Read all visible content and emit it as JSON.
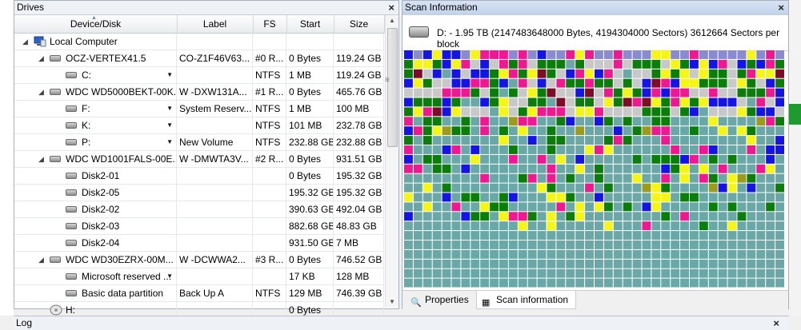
{
  "drives_panel": {
    "title": "Drives",
    "close": "×",
    "columns": [
      "Device/Disk",
      "Label",
      "FS",
      "Start",
      "Size"
    ],
    "rows": [
      {
        "level": 0,
        "expanded": true,
        "icon": "computer-icon",
        "name": "Local Computer",
        "label": "",
        "fs": "",
        "start": "",
        "size": "",
        "dropdown": false
      },
      {
        "level": 1,
        "expanded": true,
        "icon": "hard-disk-icon",
        "name": "OCZ-VERTEX41.5",
        "label": "CO-Z1F46V63...",
        "fs": "#0 R...",
        "start": "0 Bytes",
        "size": "119.24 GB",
        "dropdown": false
      },
      {
        "level": 2,
        "expanded": false,
        "icon": "partition-icon",
        "name": "C:",
        "label": "",
        "fs": "NTFS",
        "start": "1 MB",
        "size": "119.24 GB",
        "dropdown": true
      },
      {
        "level": 1,
        "expanded": true,
        "icon": "hard-disk-icon",
        "name": "WDC WD5000BEKT-00K...",
        "label": "W -DXW131A...",
        "fs": "#1 R...",
        "start": "0 Bytes",
        "size": "465.76 GB",
        "dropdown": false
      },
      {
        "level": 2,
        "expanded": false,
        "icon": "partition-icon",
        "name": "F:",
        "label": "System Reserv...",
        "fs": "NTFS",
        "start": "1 MB",
        "size": "100 MB",
        "dropdown": true
      },
      {
        "level": 2,
        "expanded": false,
        "icon": "partition-icon",
        "name": "K:",
        "label": "",
        "fs": "NTFS",
        "start": "101 MB",
        "size": "232.78 GB",
        "dropdown": true
      },
      {
        "level": 2,
        "expanded": false,
        "icon": "partition-icon",
        "name": "P:",
        "label": "New Volume",
        "fs": "NTFS",
        "start": "232.88 GB",
        "size": "232.88 GB",
        "dropdown": true
      },
      {
        "level": 1,
        "expanded": true,
        "icon": "hard-disk-icon",
        "name": "WDC WD1001FALS-00E...",
        "label": "W -DMWTA3V...",
        "fs": "#2 R...",
        "start": "0 Bytes",
        "size": "931.51 GB",
        "dropdown": false
      },
      {
        "level": 2,
        "expanded": false,
        "icon": "partition-icon",
        "name": "Disk2-01",
        "label": "",
        "fs": "",
        "start": "0 Bytes",
        "size": "195.32 GB",
        "dropdown": false
      },
      {
        "level": 2,
        "expanded": false,
        "icon": "partition-icon",
        "name": "Disk2-05",
        "label": "",
        "fs": "",
        "start": "195.32 GB",
        "size": "195.32 GB",
        "dropdown": false
      },
      {
        "level": 2,
        "expanded": false,
        "icon": "partition-icon",
        "name": "Disk2-02",
        "label": "",
        "fs": "",
        "start": "390.63 GB",
        "size": "492.04 GB",
        "dropdown": false
      },
      {
        "level": 2,
        "expanded": false,
        "icon": "partition-icon",
        "name": "Disk2-03",
        "label": "",
        "fs": "",
        "start": "882.68 GB",
        "size": "48.83 GB",
        "dropdown": false
      },
      {
        "level": 2,
        "expanded": false,
        "icon": "partition-icon",
        "name": "Disk2-04",
        "label": "",
        "fs": "",
        "start": "931.50 GB",
        "size": "7 MB",
        "dropdown": false
      },
      {
        "level": 1,
        "expanded": true,
        "icon": "hard-disk-icon",
        "name": "WDC WD30EZRX-00M...",
        "label": "W -DCWWA2...",
        "fs": "#3 R...",
        "start": "0 Bytes",
        "size": "746.52 GB",
        "dropdown": false
      },
      {
        "level": 2,
        "expanded": false,
        "icon": "partition-icon",
        "name": "Microsoft reserved ...",
        "label": "",
        "fs": "",
        "start": "17 KB",
        "size": "128 MB",
        "dropdown": true
      },
      {
        "level": 2,
        "expanded": false,
        "icon": "partition-icon",
        "name": "Basic data partition",
        "label": "Back Up A",
        "fs": "NTFS",
        "start": "129 MB",
        "size": "746.39 GB",
        "dropdown": false
      },
      {
        "level": 1,
        "expanded": false,
        "icon": "removable-drive-icon",
        "name": "H:",
        "label": "",
        "fs": "",
        "start": "0 Bytes",
        "size": "",
        "dropdown": false
      }
    ]
  },
  "scan_panel": {
    "title": "Scan Information",
    "close": "×",
    "info": "D: - 1.95 TB (2147483648000 Bytes, 4194304000 Sectors) 3612664 Sectors per block",
    "tabs": [
      {
        "label": "Properties",
        "icon": "properties-icon",
        "active": false
      },
      {
        "label": "Scan information",
        "icon": "scan-map-icon",
        "active": true
      }
    ],
    "block_colors": {
      "empty": "#6aa7a7",
      "unscanned": "#c8c8c8",
      "ntfs": "#0b7d0b",
      "fat": "#1414e6",
      "documents": "#f01890",
      "images": "#f6f614",
      "other": "#7d0c28",
      "mixed": "#9b9b1c",
      "header": "#8a8ad0"
    }
  },
  "log_panel": {
    "title": "Log",
    "close": "×"
  }
}
